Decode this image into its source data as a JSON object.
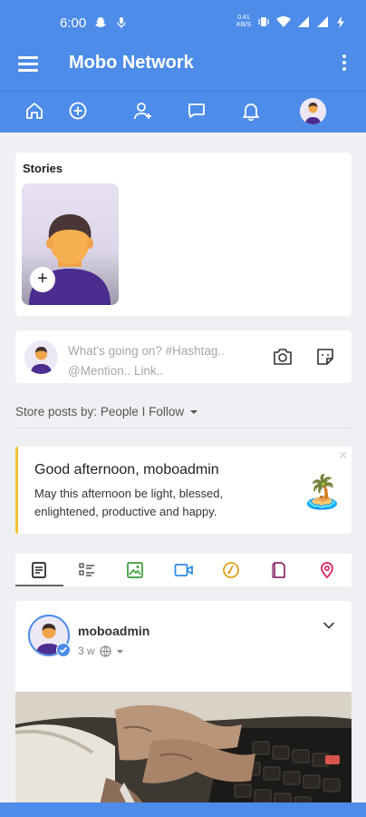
{
  "status_bar": {
    "time": "6:00",
    "net_speed_value": "0.41",
    "net_speed_unit": "KB/S"
  },
  "app_bar": {
    "title": "Mobo Network"
  },
  "stories": {
    "title": "Stories",
    "add_label": "+"
  },
  "composer": {
    "placeholder_line1": "What's going on? #Hashtag..",
    "placeholder_line2": "@Mention.. Link.."
  },
  "sort": {
    "label": "Store posts by:",
    "value": "People I Follow"
  },
  "greeting": {
    "title": "Good afternoon, moboadmin",
    "message": "May this afternoon be light, blessed, enlightened, productive and happy.",
    "close": "×",
    "emoji": "🏝️"
  },
  "post": {
    "username": "moboadmin",
    "time": "3 w"
  },
  "colors": {
    "primary": "#4d8ce8",
    "accent_yellow": "#f2c233"
  },
  "icons": {
    "filter_tabs": [
      "text-posts-icon",
      "list-icon",
      "image-icon",
      "video-icon",
      "music-icon",
      "file-icon",
      "location-icon"
    ]
  }
}
